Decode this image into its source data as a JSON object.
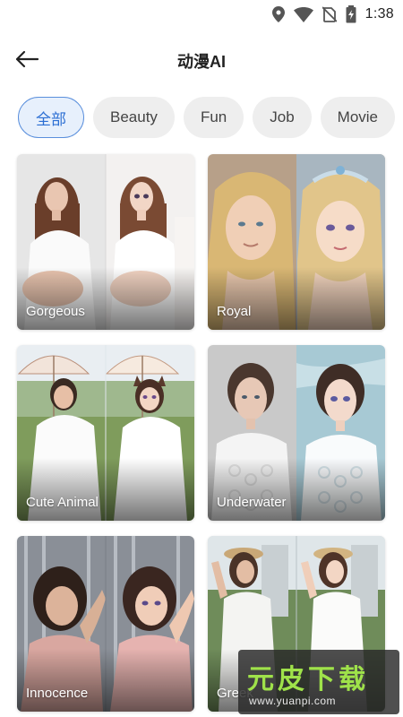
{
  "status_bar": {
    "time": "1:38",
    "icons": [
      "location-icon",
      "wifi-icon",
      "no-sim-icon",
      "battery-charging-icon"
    ]
  },
  "header": {
    "back_icon": "arrow-left-icon",
    "title": "动漫AI"
  },
  "categories": [
    {
      "label": "全部",
      "selected": true
    },
    {
      "label": "Beauty",
      "selected": false
    },
    {
      "label": "Fun",
      "selected": false
    },
    {
      "label": "Job",
      "selected": false
    },
    {
      "label": "Movie",
      "selected": false
    }
  ],
  "styles": [
    {
      "label": "Gorgeous"
    },
    {
      "label": "Royal"
    },
    {
      "label": "Cute Animal"
    },
    {
      "label": "Underwater"
    },
    {
      "label": "Innocence"
    },
    {
      "label": "Greek"
    }
  ],
  "watermark": {
    "main": "元皮下载",
    "url": "www.yuanpi.com"
  },
  "colors": {
    "accent": "#2b6ed3",
    "chip_selected_bg": "#e7f0fc",
    "chip_bg": "#eeeeee",
    "watermark_green": "#9fe24a"
  }
}
